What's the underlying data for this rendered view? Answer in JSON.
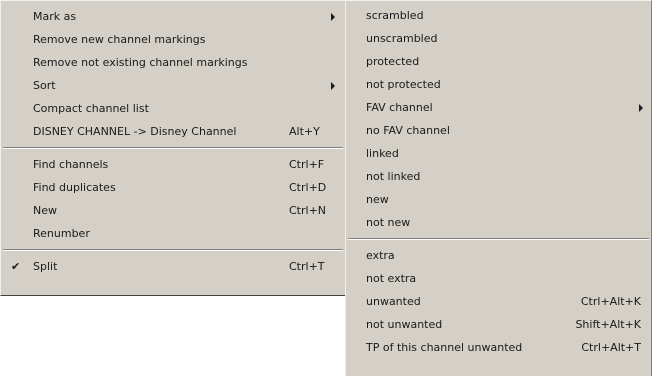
{
  "main_menu": {
    "items": [
      {
        "label": "Mark as",
        "has_submenu": true
      },
      {
        "label": "Remove new channel markings"
      },
      {
        "label": "Remove not existing channel markings"
      },
      {
        "label": "Sort",
        "has_submenu": true
      },
      {
        "label": "Compact channel list"
      },
      {
        "label": "DISNEY CHANNEL -> Disney Channel",
        "shortcut": "Alt+Y"
      },
      {
        "label": "Find channels",
        "shortcut": "Ctrl+F"
      },
      {
        "label": "Find duplicates",
        "shortcut": "Ctrl+D"
      },
      {
        "label": "New",
        "shortcut": "Ctrl+N"
      },
      {
        "label": "Renumber"
      },
      {
        "label": "Split",
        "shortcut": "Ctrl+T",
        "checked": true,
        "check_glyph": "✔"
      }
    ]
  },
  "submenu": {
    "items": [
      {
        "label": "scrambled"
      },
      {
        "label": "unscrambled"
      },
      {
        "label": "protected"
      },
      {
        "label": "not protected"
      },
      {
        "label": "FAV channel",
        "has_submenu": true
      },
      {
        "label": "no FAV channel"
      },
      {
        "label": "linked"
      },
      {
        "label": "not linked"
      },
      {
        "label": "new"
      },
      {
        "label": "not new"
      },
      {
        "label": "extra"
      },
      {
        "label": "not extra"
      },
      {
        "label": "unwanted",
        "shortcut": "Ctrl+Alt+K"
      },
      {
        "label": "not unwanted",
        "shortcut": "Shift+Alt+K"
      },
      {
        "label": "TP of this channel unwanted",
        "shortcut": "Ctrl+Alt+T"
      }
    ]
  },
  "colors": {
    "menu_background": "#d4d0c8",
    "text": "#1a1a1a"
  }
}
